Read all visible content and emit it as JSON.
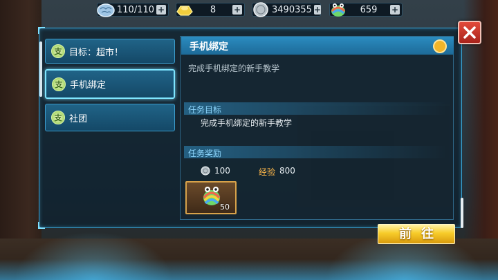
{
  "colors": {
    "panel_border": "#3aa5d6",
    "mission_bg": "#1d6a98",
    "accent_gold": "#f7cc2a",
    "exp_orange": "#ffb84a",
    "section_blue": "#8fd8ff"
  },
  "resources": {
    "stamina": {
      "value": "110/110",
      "icon": "brain-icon"
    },
    "gold": {
      "value": "8",
      "icon": "gold-ingot-icon"
    },
    "silver": {
      "value": "3490355",
      "icon": "silver-coin-icon"
    },
    "frog": {
      "value": "659",
      "icon": "rainbow-frog-icon"
    },
    "plus": "+"
  },
  "missions": [
    {
      "label": "目标：超市！",
      "badge": "支"
    },
    {
      "label": "手机绑定",
      "badge": "支"
    },
    {
      "label": "社团",
      "badge": "支"
    }
  ],
  "detail": {
    "title": "手机绑定",
    "description": "完成手机绑定的新手教学",
    "target_heading": "任务目标",
    "target_text": "完成手机绑定的新手教学",
    "reward_heading": "任务奖励",
    "reward_coins": "100",
    "exp_label": "经验",
    "exp_value": "800",
    "item_count": "50"
  },
  "go_button": "前往"
}
